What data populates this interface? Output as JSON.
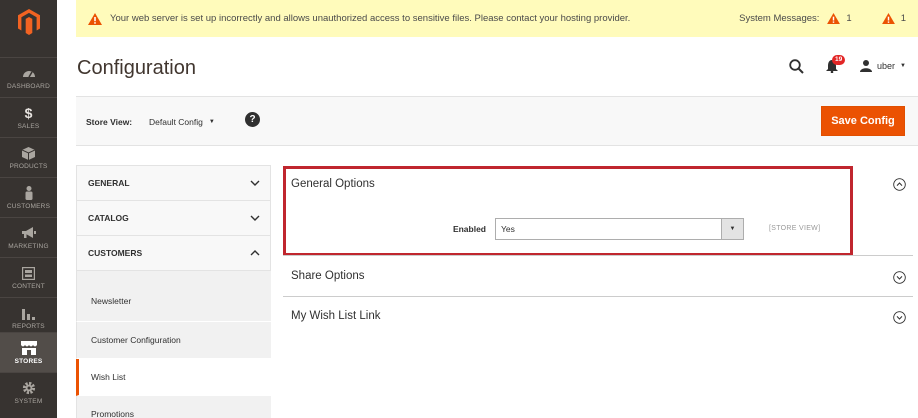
{
  "nav": {
    "items": [
      {
        "label": "DASHBOARD",
        "icon": "dashboard-icon"
      },
      {
        "label": "SALES",
        "icon": "dollar-icon"
      },
      {
        "label": "PRODUCTS",
        "icon": "box-icon"
      },
      {
        "label": "CUSTOMERS",
        "icon": "person-icon"
      },
      {
        "label": "MARKETING",
        "icon": "megaphone-icon"
      },
      {
        "label": "CONTENT",
        "icon": "layout-icon"
      },
      {
        "label": "REPORTS",
        "icon": "bar-chart-icon"
      },
      {
        "label": "STORES",
        "icon": "storefront-icon"
      },
      {
        "label": "SYSTEM",
        "icon": "gear-icon"
      }
    ],
    "active": "STORES"
  },
  "message_bar": {
    "text": "Your web server is set up incorrectly and allows unauthorized access to sensitive files. Please contact your hosting provider.",
    "system_label": "System Messages:",
    "count_1": "1",
    "count_2": "1"
  },
  "header": {
    "title": "Configuration",
    "notification_count": "19",
    "user_name": "uber"
  },
  "store_bar": {
    "label": "Store View:",
    "selected": "Default Config",
    "help": "?",
    "save_label": "Save Config"
  },
  "tabs": {
    "general": "GENERAL",
    "catalog": "CATALOG",
    "customers": "CUSTOMERS",
    "sub_items": [
      "Newsletter",
      "Customer Configuration",
      "Wish List",
      "Promotions"
    ],
    "active_sub": "Wish List"
  },
  "groups": {
    "general_options": "General Options",
    "share_options": "Share Options",
    "wish_list_link": "My Wish List Link"
  },
  "field": {
    "label": "Enabled",
    "value": "Yes",
    "scope": "[STORE VIEW]"
  },
  "colors": {
    "accent": "#eb5202",
    "highlight": "#c0262e",
    "sidebar": "#373330",
    "message_bg": "#fffbbb"
  }
}
